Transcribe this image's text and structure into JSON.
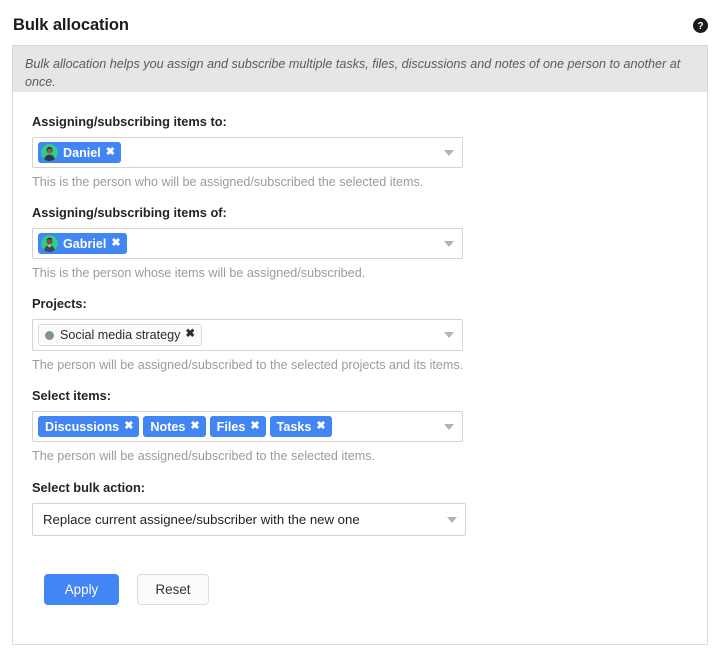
{
  "header": {
    "title": "Bulk allocation",
    "help_icon": "help-circle-icon"
  },
  "info_banner": {
    "text": "Bulk allocation helps you assign and subscribe multiple tasks, files, discussions and notes of one person to another at once."
  },
  "colors": {
    "accent": "#4285f4",
    "banner_bg": "#e6e6e6",
    "panel_border": "#dedede",
    "hint_text": "#9b9b9b",
    "project_dot": "#7e919e"
  },
  "fields": {
    "assign_to": {
      "label": "Assigning/subscribing items to:",
      "chips": [
        {
          "name": "Daniel",
          "avatar": "user-avatar",
          "remove": "✖"
        }
      ],
      "hint": "This is the person who will be assigned/subscribed the selected items.",
      "caret": "chevron-down-icon"
    },
    "assign_of": {
      "label": "Assigning/subscribing items of:",
      "chips": [
        {
          "name": "Gabriel",
          "avatar": "user-avatar",
          "remove": "✖"
        }
      ],
      "hint": "This is the person whose items will be assigned/subscribed.",
      "caret": "chevron-down-icon"
    },
    "projects": {
      "label": "Projects:",
      "chips": [
        {
          "name": "Social media strategy",
          "dot": "project-color-dot",
          "remove": "✖"
        }
      ],
      "hint": "The person will be assigned/subscribed to the selected projects and its items.",
      "caret": "chevron-down-icon"
    },
    "items": {
      "label": "Select items:",
      "chips": [
        {
          "name": "Discussions",
          "remove": "✖"
        },
        {
          "name": "Notes",
          "remove": "✖"
        },
        {
          "name": "Files",
          "remove": "✖"
        },
        {
          "name": "Tasks",
          "remove": "✖"
        }
      ],
      "hint": "The person will be assigned/subscribed to the selected items.",
      "caret": "chevron-down-icon"
    },
    "bulk_action": {
      "label": "Select bulk action:",
      "value": "Replace current assignee/subscriber with the new one",
      "caret": "chevron-down-icon"
    }
  },
  "buttons": {
    "apply": "Apply",
    "reset": "Reset"
  }
}
